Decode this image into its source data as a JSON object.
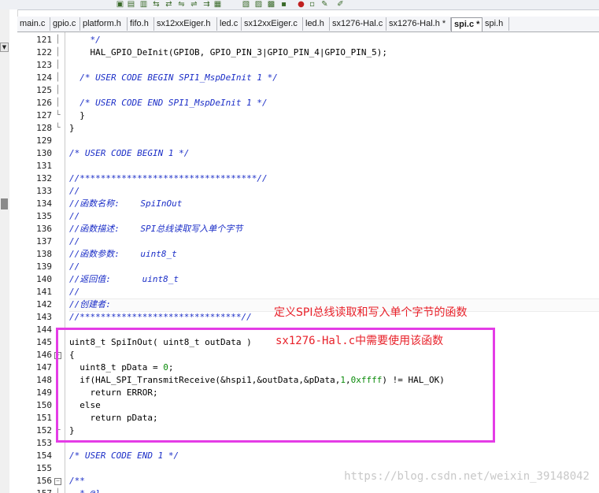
{
  "tabs": [
    {
      "label": "main.c",
      "active": false
    },
    {
      "label": "gpio.c",
      "active": false
    },
    {
      "label": "platform.h",
      "active": false
    },
    {
      "label": "fifo.h",
      "active": false
    },
    {
      "label": "sx12xxEiger.h",
      "active": false
    },
    {
      "label": "led.c",
      "active": false
    },
    {
      "label": "sx12xxEiger.c",
      "active": false
    },
    {
      "label": "led.h",
      "active": false
    },
    {
      "label": "sx1276-Hal.c",
      "active": false
    },
    {
      "label": "sx1276-Hal.h *",
      "active": false
    },
    {
      "label": "spi.c *",
      "active": true
    },
    {
      "label": "spi.h",
      "active": false
    }
  ],
  "left_panel": {
    "arrow": "▼"
  },
  "lines": [
    {
      "n": "121",
      "text": "    */",
      "type": "comment",
      "fold": "line"
    },
    {
      "n": "122",
      "text": "    HAL_GPIO_DeInit(GPIOB, GPIO_PIN_3|GPIO_PIN_4|GPIO_PIN_5);",
      "type": "code",
      "fold": "line"
    },
    {
      "n": "123",
      "text": "",
      "type": "code",
      "fold": "line"
    },
    {
      "n": "124",
      "text": "  /* USER CODE BEGIN SPI1_MspDeInit 1 */",
      "type": "comment",
      "fold": "line"
    },
    {
      "n": "125",
      "text": "",
      "type": "code",
      "fold": "line"
    },
    {
      "n": "126",
      "text": "  /* USER CODE END SPI1_MspDeInit 1 */",
      "type": "comment",
      "fold": "line"
    },
    {
      "n": "127",
      "text": "  }",
      "type": "code",
      "fold": "end"
    },
    {
      "n": "128",
      "text": "}",
      "type": "code",
      "fold": "end"
    },
    {
      "n": "129",
      "text": "",
      "type": "code",
      "fold": ""
    },
    {
      "n": "130",
      "text": "/* USER CODE BEGIN 1 */",
      "type": "comment",
      "fold": ""
    },
    {
      "n": "131",
      "text": "",
      "type": "code",
      "fold": ""
    },
    {
      "n": "132",
      "text": "//**********************************//",
      "type": "comment",
      "fold": ""
    },
    {
      "n": "133",
      "text": "//",
      "type": "comment",
      "fold": ""
    },
    {
      "n": "134",
      "text": "//函数名称:    SpiInOut",
      "type": "comment",
      "fold": ""
    },
    {
      "n": "135",
      "text": "//",
      "type": "comment",
      "fold": ""
    },
    {
      "n": "136",
      "text": "//函数描述:    SPI总线读取写入单个字节",
      "type": "comment",
      "fold": ""
    },
    {
      "n": "137",
      "text": "//",
      "type": "comment",
      "fold": ""
    },
    {
      "n": "138",
      "text": "//函数参数:    uint8_t",
      "type": "comment",
      "fold": ""
    },
    {
      "n": "139",
      "text": "//",
      "type": "comment",
      "fold": ""
    },
    {
      "n": "140",
      "text": "//返回值:      uint8_t",
      "type": "comment",
      "fold": ""
    },
    {
      "n": "141",
      "text": "//",
      "type": "comment",
      "fold": ""
    },
    {
      "n": "142",
      "text": "//创建者:",
      "type": "comment",
      "fold": ""
    },
    {
      "n": "143",
      "text": "//*******************************//",
      "type": "comment",
      "fold": ""
    },
    {
      "n": "144",
      "text": "",
      "type": "code",
      "fold": ""
    },
    {
      "n": "145",
      "text": "uint8_t SpiInOut( uint8_t outData )",
      "type": "code",
      "fold": ""
    },
    {
      "n": "146",
      "text": "{",
      "type": "code",
      "fold": "box"
    },
    {
      "n": "147",
      "text": "  uint8_t pData = 0;",
      "type": "code",
      "fold": "line"
    },
    {
      "n": "148",
      "text": "  if(HAL_SPI_TransmitReceive(&hspi1,&outData,&pData,1,0xffff) != HAL_OK)",
      "type": "code",
      "fold": "line"
    },
    {
      "n": "149",
      "text": "    return ERROR;",
      "type": "code",
      "fold": "line"
    },
    {
      "n": "150",
      "text": "  else",
      "type": "code",
      "fold": "line"
    },
    {
      "n": "151",
      "text": "    return pData;",
      "type": "code",
      "fold": "line"
    },
    {
      "n": "152",
      "text": "}",
      "type": "code",
      "fold": "end"
    },
    {
      "n": "153",
      "text": "",
      "type": "code",
      "fold": ""
    },
    {
      "n": "154",
      "text": "/* USER CODE END 1 */",
      "type": "comment",
      "fold": ""
    },
    {
      "n": "155",
      "text": "",
      "type": "code",
      "fold": ""
    },
    {
      "n": "156",
      "text": "/**",
      "type": "comment",
      "fold": "box"
    },
    {
      "n": "157",
      "text": "  * @}",
      "type": "comment",
      "fold": "line"
    }
  ],
  "annotations": {
    "line1": "定义SPI总线读取和写入单个字节的函数",
    "line2": "sx1276-Hal.c中需要使用该函数",
    "box_color": "#e43ce6",
    "text_color": "#e8212a"
  },
  "watermark": "https://blog.csdn.net/weixin_39148042",
  "colors": {
    "comment": "#1b2ec7",
    "number": "#0a8a0a",
    "code": "#000000"
  }
}
